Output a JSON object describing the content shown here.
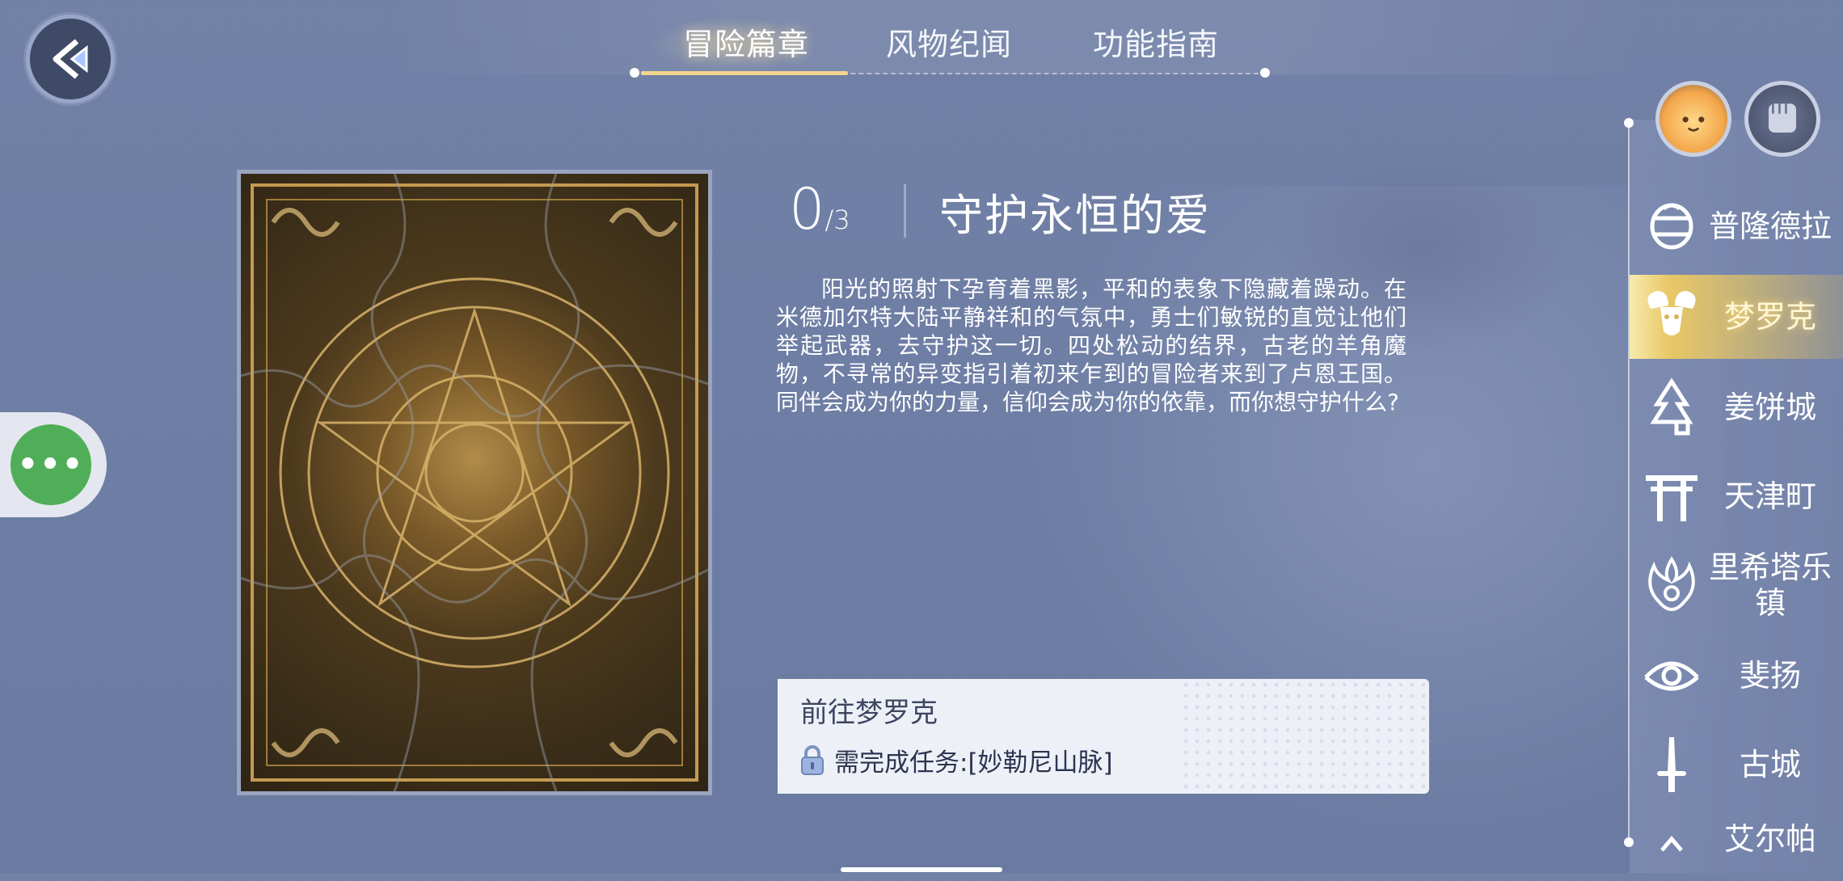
{
  "tabs": [
    {
      "label": "冒险篇章",
      "active": true
    },
    {
      "label": "风物纪闻",
      "active": false
    },
    {
      "label": "功能指南",
      "active": false
    }
  ],
  "chapter": {
    "progress_current": "0",
    "progress_total": "/3",
    "title": "守护永恒的爱",
    "story": "阳光的照射下孕育着黑影，平和的表象下隐藏着躁动。在米德加尔特大陆平静祥和的气氛中，勇士们敏锐的直觉让他们举起武器，去守护这一切。四处松动的结界，古老的羊角魔物，不寻常的异变指引着初来乍到的冒险者来到了卢恩王国。同伴会成为你的力量，信仰会成为你的依靠，而你想守护什么?"
  },
  "goto": {
    "title": "前往梦罗克",
    "requirement": "需完成任务:[妙勒尼山脉]"
  },
  "regions": [
    {
      "label": "普隆德拉",
      "icon": "prontera-emblem-icon",
      "active": false
    },
    {
      "label": "梦罗克",
      "icon": "ram-skull-icon",
      "active": true
    },
    {
      "label": "姜饼城",
      "icon": "gingerbread-tree-icon",
      "active": false
    },
    {
      "label": "天津町",
      "icon": "torii-gate-icon",
      "active": false
    },
    {
      "label": "里希塔乐镇",
      "icon": "flame-emblem-icon",
      "active": false
    },
    {
      "label": "斐扬",
      "icon": "eye-emblem-icon",
      "active": false
    },
    {
      "label": "古城",
      "icon": "sword-emblem-icon",
      "active": false
    },
    {
      "label": "艾尔帕",
      "icon": "partial-emblem-icon",
      "active": false
    }
  ],
  "colors": {
    "background": "#6e7ea4",
    "accent_gold": "#f2d58e",
    "menu_green": "#4fae57",
    "goto_box": "#edf0f6"
  }
}
